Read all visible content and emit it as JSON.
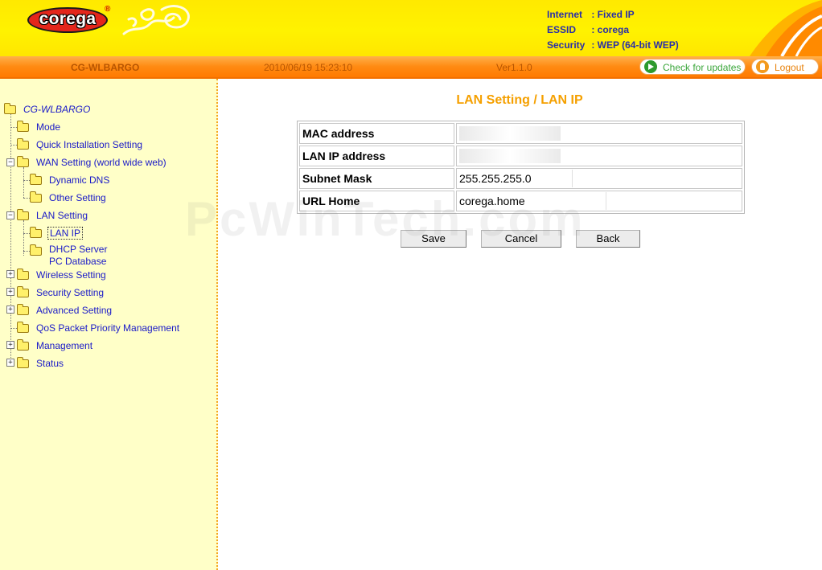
{
  "header": {
    "logo_text": "corega",
    "logo_reg": "®",
    "info": [
      {
        "key": "Internet",
        "value": ": Fixed IP"
      },
      {
        "key": "ESSID",
        "value": ": corega"
      },
      {
        "key": "Security",
        "value": ": WEP (64-bit WEP)"
      }
    ]
  },
  "statusbar": {
    "model": "CG-WLBARGO",
    "datetime": "2010/06/19 15:23:10",
    "version": "Ver1.1.0",
    "check_updates_label": "Check for updates",
    "logout_label": "Logout"
  },
  "sidebar": {
    "root": "CG-WLBARGO",
    "items": {
      "mode": "Mode",
      "quick": "Quick Installation Setting",
      "wan": "WAN Setting (world wide web)",
      "ddns": "Dynamic DNS",
      "other": "Other Setting",
      "lan": "LAN Setting",
      "lanip": "LAN IP",
      "dhcp": "DHCP Server",
      "pcdb": "PC Database",
      "wireless": "Wireless Setting",
      "security": "Security Setting",
      "advanced": "Advanced Setting",
      "qos": "QoS Packet Priority Management",
      "management": "Management",
      "status": "Status"
    }
  },
  "main": {
    "title": "LAN Setting / LAN IP",
    "rows": [
      {
        "label": "MAC address",
        "value": ""
      },
      {
        "label": "LAN IP address",
        "value": ""
      },
      {
        "label": "Subnet Mask",
        "value": "255.255.255.0"
      },
      {
        "label": "URL Home",
        "value": "corega.home"
      }
    ],
    "buttons": {
      "save": "Save",
      "cancel": "Cancel",
      "back": "Back"
    }
  },
  "watermark": "PcWinTech.com",
  "colors": {
    "accent_orange": "#ff8a12",
    "header_yellow": "#fff200",
    "title_orange": "#f5a000",
    "link_blue": "#1a1ac8"
  }
}
